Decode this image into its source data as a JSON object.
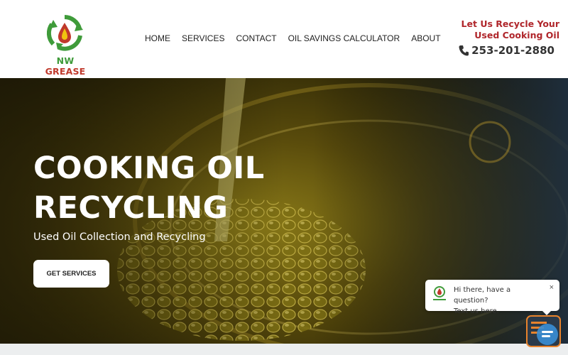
{
  "brand": {
    "name_part1": "NW",
    "name_part2": "GREASE"
  },
  "nav": {
    "items": [
      {
        "label": "HOME"
      },
      {
        "label": "SERVICES"
      },
      {
        "label": "CONTACT"
      },
      {
        "label": "OIL SAVINGS CALCULATOR"
      },
      {
        "label": "ABOUT"
      }
    ]
  },
  "callout": {
    "line1": "Let Us Recycle Your",
    "line2": "Used Cooking Oil",
    "phone": "253-201-2880"
  },
  "hero": {
    "title_line1": "COOKING OIL",
    "title_line2": "RECYCLING",
    "subtitle": "Used Oil Collection and Recycling",
    "cta_label": "GET SERVICES"
  },
  "chat": {
    "line1": "Hi there, have a question?",
    "line2": "Text us here.",
    "close_glyph": "×"
  },
  "colors": {
    "brand_green": "#3f9b3a",
    "brand_red": "#b0262b",
    "chat_orange": "#e8832c"
  },
  "icons": {
    "phone": "phone-icon",
    "close": "close-icon",
    "chat": "chat-launcher-icon",
    "logo": "recycle-drop-icon"
  }
}
